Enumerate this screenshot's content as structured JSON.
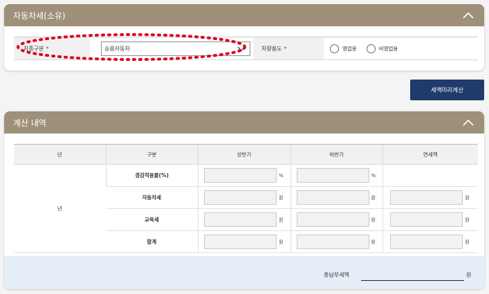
{
  "vehicle_section": {
    "title": "자동차세(소유)",
    "vehicle_type_label": "차종구분",
    "vehicle_type_value": "승용자동차",
    "usage_label": "차량용도",
    "required_mark": "*",
    "usage_options": [
      "영업용",
      "비영업용"
    ]
  },
  "calc_button_label": "세액미리계산",
  "result_section": {
    "title": "계산 내역",
    "columns": [
      "년",
      "구분",
      "상반기",
      "하반기",
      "연세액"
    ],
    "year_value": "년",
    "rows": [
      {
        "label": "경감적용율(%)",
        "unit": "%"
      },
      {
        "label": "자동차세",
        "unit": "원"
      },
      {
        "label": "교육세",
        "unit": "원"
      },
      {
        "label": "합계",
        "unit": "원"
      }
    ],
    "total_label": "총납부세액",
    "total_unit": "원"
  },
  "colors": {
    "header": "#9e9079",
    "button": "#1f3a6b",
    "highlight": "#e0001a"
  }
}
